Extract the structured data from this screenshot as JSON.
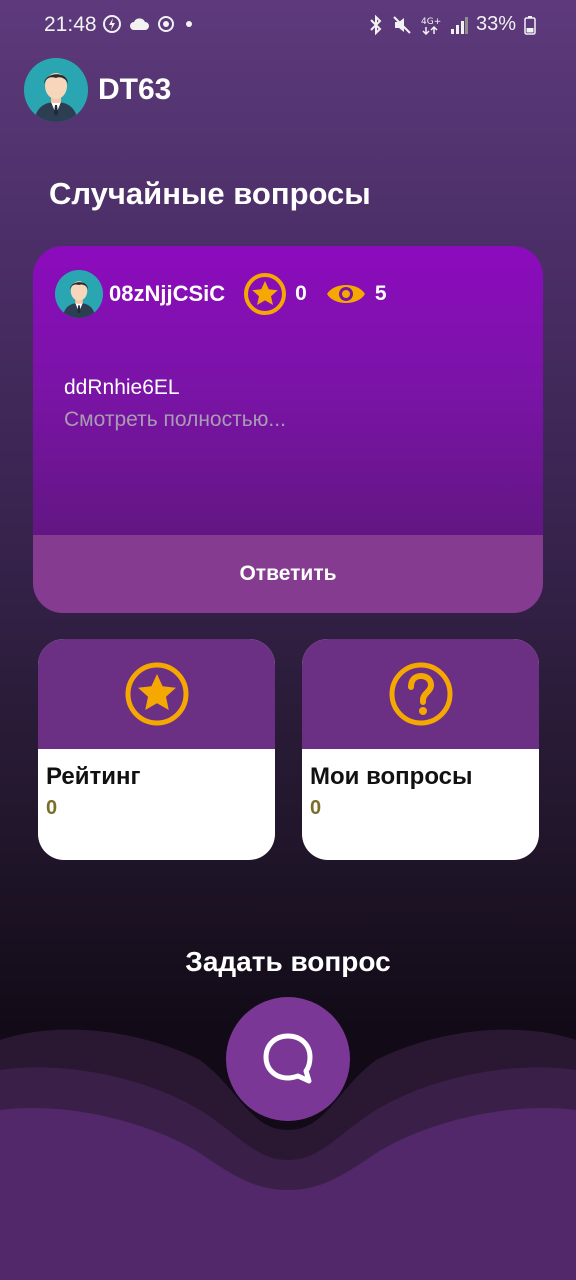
{
  "status_bar": {
    "time": "21:48",
    "battery": "33%"
  },
  "header": {
    "username": "DT63"
  },
  "random_questions": {
    "title": "Случайные вопросы",
    "card": {
      "author": "08zNjjCSiC",
      "stars": "0",
      "views": "5",
      "text": "ddRnhie6EL",
      "see_more": "Смотреть полностью...",
      "answer_label": "Ответить"
    }
  },
  "tiles": [
    {
      "label": "Рейтинг",
      "value": "0",
      "icon": "star-icon"
    },
    {
      "label": "Мои вопросы",
      "value": "0",
      "icon": "question-icon"
    }
  ],
  "ask": {
    "title": "Задать вопрос",
    "icon": "chat-bubble-icon"
  },
  "colors": {
    "accent": "#f5a800",
    "card_purple": "#8c0bbd",
    "answer_bar": "#853b90",
    "tile_header": "#6b2f84",
    "value_olive": "#7a6e2a"
  }
}
